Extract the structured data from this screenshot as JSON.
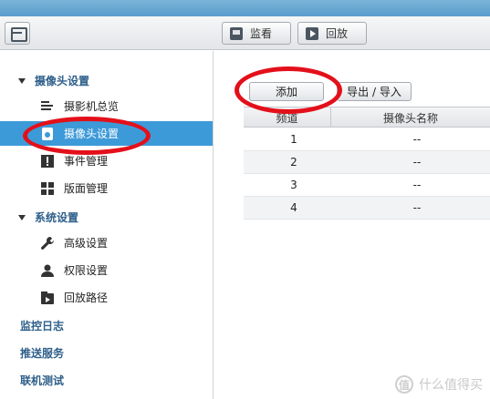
{
  "toolbar": {
    "menu_icon": "window-menu-icon",
    "live_label": "监看",
    "live_icon": "monitor-icon",
    "playback_label": "回放",
    "playback_icon": "play-icon"
  },
  "sidebar": {
    "group_camera": "摄像头设置",
    "items_camera": [
      {
        "label": "摄影机总览",
        "icon": "camera-list-icon"
      },
      {
        "label": "摄像头设置",
        "icon": "camera-settings-icon",
        "active": true
      },
      {
        "label": "事件管理",
        "icon": "event-icon"
      },
      {
        "label": "版面管理",
        "icon": "layout-grid-icon"
      }
    ],
    "group_system": "系统设置",
    "items_system": [
      {
        "label": "高级设置",
        "icon": "wrench-icon"
      },
      {
        "label": "权限设置",
        "icon": "user-icon"
      },
      {
        "label": "回放路径",
        "icon": "playback-path-icon"
      }
    ],
    "top_links": [
      "监控日志",
      "推送服务",
      "联机测试"
    ]
  },
  "main": {
    "add_label": "添加",
    "io_label": "导出 / 导入",
    "columns": [
      "频道",
      "摄像头名称"
    ],
    "rows": [
      {
        "channel": "1",
        "name": "--"
      },
      {
        "channel": "2",
        "name": "--"
      },
      {
        "channel": "3",
        "name": "--"
      },
      {
        "channel": "4",
        "name": "--"
      }
    ]
  },
  "watermark": {
    "badge": "值",
    "text": "什么值得买"
  },
  "colors": {
    "accent": "#3d9ad8",
    "highlight_ring": "#e3101a",
    "group_text": "#2e5f8a"
  }
}
